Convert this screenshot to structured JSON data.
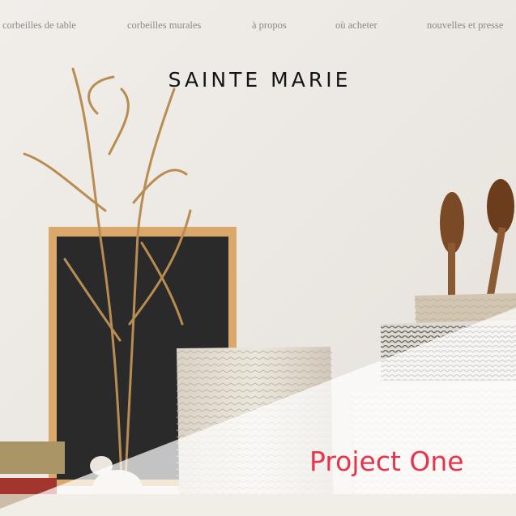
{
  "nav": {
    "items": [
      {
        "label": "corbeilles de table"
      },
      {
        "label": "corbeilles murales"
      },
      {
        "label": "à propos"
      },
      {
        "label": "où acheter"
      },
      {
        "label": "nouvelles et presse"
      }
    ]
  },
  "logo": {
    "text": "SAINTE MARIE"
  },
  "project": {
    "title": "Project One"
  },
  "colors": {
    "background": "#eeeae5",
    "nav_text": "#8d8a86",
    "logo": "#141414",
    "accent": "#e8344a",
    "overlay": "#ffffff"
  }
}
